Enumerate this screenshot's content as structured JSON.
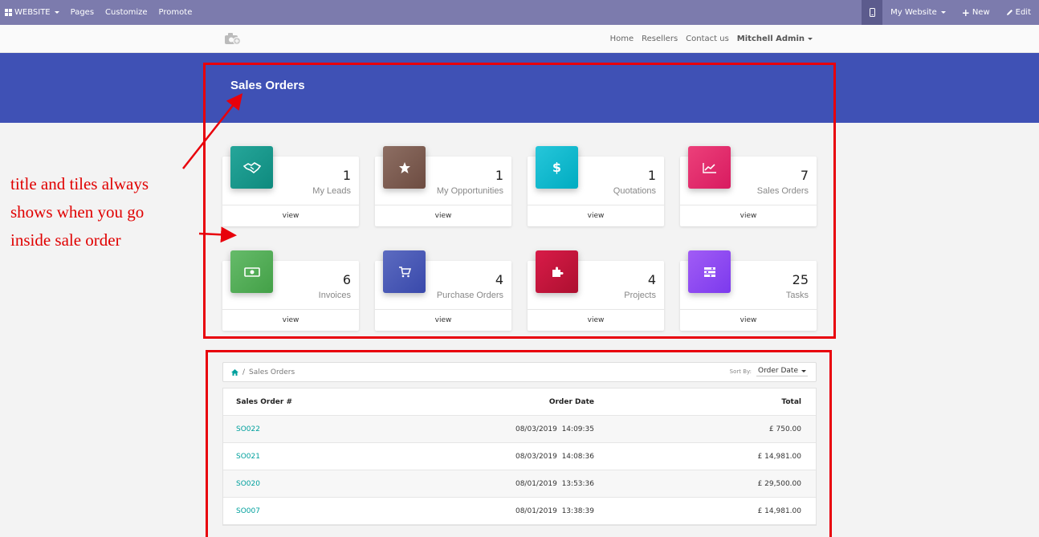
{
  "admin_bar": {
    "website_menu": "WEBSITE",
    "pages": "Pages",
    "customize": "Customize",
    "promote": "Promote",
    "my_website": "My Website",
    "new": "New",
    "edit": "Edit"
  },
  "site_nav": {
    "links": [
      "Home",
      "Resellers",
      "Contact us"
    ],
    "user": "Mitchell Admin"
  },
  "banner": {
    "title": "Sales Orders"
  },
  "tiles": [
    {
      "count": "1",
      "label": "My Leads",
      "view": "view",
      "color": "#13978f",
      "icon": "handshake-icon"
    },
    {
      "count": "1",
      "label": "My Opportunities",
      "view": "view",
      "color": "#7b5549",
      "icon": "star-icon"
    },
    {
      "count": "1",
      "label": "Quotations",
      "view": "view",
      "color": "#1ab6cf",
      "icon": "dollar-icon"
    },
    {
      "count": "7",
      "label": "Sales Orders",
      "view": "view",
      "color": "#e52a6f",
      "icon": "line-chart-icon"
    },
    {
      "count": "6",
      "label": "Invoices",
      "view": "view",
      "color": "#4caf50",
      "icon": "money-icon"
    },
    {
      "count": "4",
      "label": "Purchase Orders",
      "view": "view",
      "color": "#3f51b5",
      "icon": "cart-icon"
    },
    {
      "count": "4",
      "label": "Projects",
      "view": "view",
      "color": "#c2123f",
      "icon": "puzzle-icon"
    },
    {
      "count": "25",
      "label": "Tasks",
      "view": "view",
      "color": "#8848f0",
      "icon": "tasks-icon"
    }
  ],
  "annotation": {
    "line1": "title and tiles always",
    "line2": "shows when you go",
    "line3": "inside sale order"
  },
  "breadcrumb": {
    "current": "Sales Orders"
  },
  "sort": {
    "label": "Sort By:",
    "value": "Order Date"
  },
  "orders_table": {
    "headers": [
      "Sales Order #",
      "Order Date",
      "Total"
    ],
    "rows": [
      {
        "order": "SO022",
        "date": "08/03/2019  14:09:35",
        "total": "£ 750.00"
      },
      {
        "order": "SO021",
        "date": "08/03/2019  14:08:36",
        "total": "£ 14,981.00"
      },
      {
        "order": "SO020",
        "date": "08/01/2019  13:53:36",
        "total": "£ 29,500.00"
      },
      {
        "order": "SO007",
        "date": "08/01/2019  13:38:39",
        "total": "£ 14,981.00"
      }
    ]
  },
  "colors": {
    "admin_bar": "#7c7bad",
    "banner": "#3f51b5",
    "annotation": "#e8000b",
    "link": "#00a09d"
  }
}
